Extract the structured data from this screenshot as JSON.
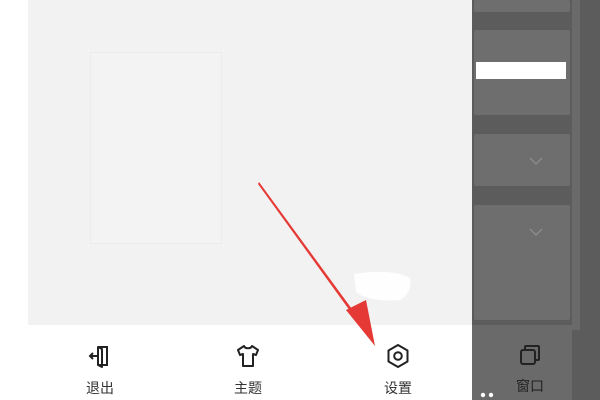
{
  "bottom_bar": {
    "tabs": [
      {
        "label": "退出",
        "icon": "exit-icon"
      },
      {
        "label": "主题",
        "icon": "shirt-icon"
      },
      {
        "label": "设置",
        "icon": "gear-icon"
      }
    ]
  },
  "overlay": {
    "tab": {
      "label": "窗口",
      "icon": "window-icon"
    }
  },
  "annotation": {
    "color": "#e53935",
    "target": "settings"
  }
}
